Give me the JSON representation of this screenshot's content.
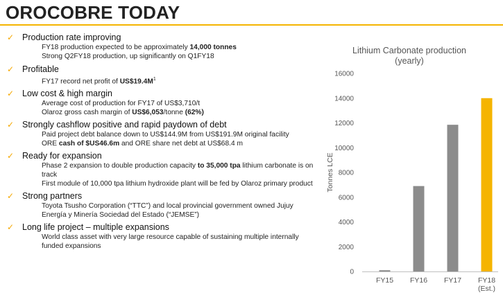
{
  "page": {
    "title": "OROCOBRE TODAY",
    "accent_color": "#f5b400",
    "tick_icon": "check-mark-icon"
  },
  "bullets": [
    {
      "head": "Production rate improving",
      "subs": [
        [
          {
            "t": "FY18 production expected to be approximately "
          },
          {
            "t": "14,000 tonnes",
            "b": true
          }
        ],
        [
          {
            "t": "Strong Q2FY18 production, up significantly on Q1FY18"
          }
        ]
      ]
    },
    {
      "head": "Profitable",
      "subs": [
        [
          {
            "t": "FY17 record net profit of "
          },
          {
            "t": "US$19.4M",
            "b": true
          },
          {
            "t": "1",
            "sup": true
          }
        ]
      ]
    },
    {
      "head": "Low cost & high margin",
      "subs": [
        [
          {
            "t": "Average cost of production for FY17 of US$3,710/t"
          }
        ],
        [
          {
            "t": "Olaroz gross cash margin of "
          },
          {
            "t": "US$6,053",
            "b": true
          },
          {
            "t": "/tonne "
          },
          {
            "t": "(62%)",
            "b": true
          }
        ]
      ]
    },
    {
      "head": "Strongly cashflow positive and rapid paydown of debt",
      "subs": [
        [
          {
            "t": "Paid project debt balance down to US$144.9M from US$191.9M original facility"
          }
        ],
        [
          {
            "t": "ORE "
          },
          {
            "t": "cash of $US46.6m",
            "b": true
          },
          {
            "t": " and ORE share net debt at US$68.4 m"
          }
        ]
      ]
    },
    {
      "head": "Ready for expansion",
      "subs": [
        [
          {
            "t": "Phase 2 expansion to double production capacity "
          },
          {
            "t": "to 35,000 tpa",
            "b": true
          },
          {
            "t": " lithium carbonate is on track"
          }
        ],
        [
          {
            "t": "First module of 10,000 tpa lithium hydroxide plant will be fed by Olaroz primary product"
          }
        ]
      ]
    },
    {
      "head": "Strong partners",
      "subs": [
        [
          {
            "t": "Toyota Tsusho Corporation (“TTC”) and local provincial government owned Jujuy Energía y Minería Sociedad del Estado (“JEMSE”)"
          }
        ]
      ]
    },
    {
      "head": "Long life project – multiple expansions",
      "subs": [
        [
          {
            "t": "World class asset with very large resource capable of sustaining multiple internally funded expansions"
          }
        ]
      ]
    }
  ],
  "chart_data": {
    "type": "bar",
    "title": "Lithium Carbonate production",
    "subtitle": "(yearly)",
    "ylabel": "Tonnes LCE",
    "xlabel": "",
    "categories": [
      "FY15",
      "FY16",
      "FY17",
      "FY18\n(Est.)"
    ],
    "values": [
      100,
      6900,
      11850,
      14000
    ],
    "colors": [
      "#8c8c8c",
      "#8c8c8c",
      "#8c8c8c",
      "#f5b400"
    ],
    "ylim": [
      0,
      16000
    ],
    "yticks": [
      0,
      2000,
      4000,
      6000,
      8000,
      10000,
      12000,
      14000,
      16000
    ],
    "grid": false,
    "legend": "none"
  }
}
